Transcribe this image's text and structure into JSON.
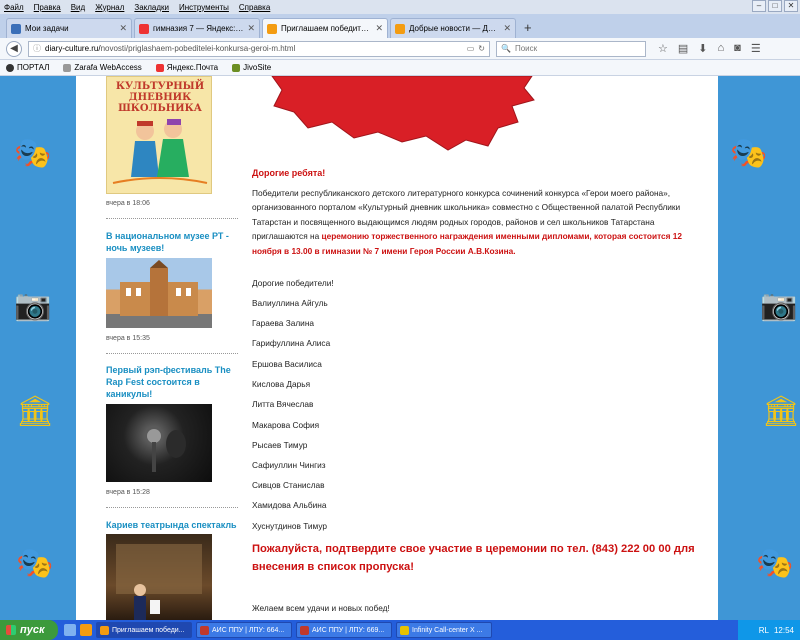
{
  "menu": [
    "Файл",
    "Правка",
    "Вид",
    "Журнал",
    "Закладки",
    "Инструменты",
    "Справка"
  ],
  "tabs": [
    {
      "label": "Мои задачи",
      "color": "#3b6fb8",
      "active": false
    },
    {
      "label": "гимназия 7 — Яндекс: нашл...",
      "color": "#e33",
      "active": false
    },
    {
      "label": "Приглашаем победителей конкур...",
      "color": "#f39c12",
      "active": true
    },
    {
      "label": "Добрые новости — Дневник до...",
      "color": "#f39c12",
      "active": false
    }
  ],
  "address": {
    "prefix": "diary-culture.ru/",
    "path": "novosti/priglashaem-pobeditelei-konkursa-geroi-m.html"
  },
  "search": {
    "placeholder": "Поиск"
  },
  "bookmarks": [
    {
      "label": "ПОРТАЛ",
      "color": "#333"
    },
    {
      "label": "Zarafa WebAccess",
      "color": "#555"
    },
    {
      "label": "Яндекс.Почта",
      "color": "#e33"
    },
    {
      "label": "JivoSite",
      "color": "#6b8e23"
    }
  ],
  "sidebar": {
    "logo": {
      "line1": "КУЛЬТУРНЫЙ",
      "line2": "ДНЕВНИК",
      "line3": "ШКОЛЬНИКА"
    },
    "items": [
      {
        "title": "",
        "time": "вчера в 18:06"
      },
      {
        "title": "В национальном музее РТ - ночь музеев!",
        "time": "вчера в 15:35"
      },
      {
        "title": "Первый рэп-фестиваль The Rap Fest состоится в каникулы!",
        "time": "вчера в 15:28"
      },
      {
        "title": "Кариев театрында спектакль",
        "time": ""
      }
    ]
  },
  "main": {
    "greeting": "Дорогие ребята!",
    "para_normal": "Победители республиканского детского литературного конкурса сочинений конкурса «Герои моего района», организованного порталом «Культурный дневник школьника» совместно с Общественной палатой Республики Татарстан и посвященного выдающимся людям родных городов, районов и сел школьников Татарстана приглашаются  на ",
    "para_red": "церемонию торжественного награждения именными дипломами, которая состоится 12 ноября в 13.00 в гимназии № 7 имени Героя России А.В.Козина.",
    "winners_title": "Дорогие победители!",
    "winners": [
      "Валиуллина Айгуль",
      "Гараева Залина",
      "Гарифуллина Алиса",
      "Ершова Василиса",
      "Кислова Дарья",
      "Литта Вячеслав",
      "Макарова София",
      "Рысаев Тимур",
      "Сафиуллин Чингиз",
      "Сивцов Станислав",
      "Хамидова Альбина",
      "Хуснутдинов Тимур"
    ],
    "confirm": "Пожалуйста, подтвердите свое участие в церемонии по тел. (843) 222 00 00 для внесения в список пропуска!",
    "wish": "Желаем всем удачи и новых побед!"
  },
  "taskbar": {
    "start": "пуск",
    "tasks": [
      {
        "label": "Приглашаем победи...",
        "color": "#f39c12",
        "active": true
      },
      {
        "label": "АИС ППУ | ЛПУ: 664...",
        "color": "#c0392b",
        "active": false
      },
      {
        "label": "АИС ППУ | ЛПУ: 669...",
        "color": "#c0392b",
        "active": false
      },
      {
        "label": "Infinity Call-center X ...",
        "color": "#e6c200",
        "active": false
      }
    ],
    "lang": "RL",
    "clock": "12:54"
  },
  "colors": {
    "page_bg": "#3f96d6",
    "accent_red": "#cc1111",
    "link_blue": "#1a8fc2"
  }
}
